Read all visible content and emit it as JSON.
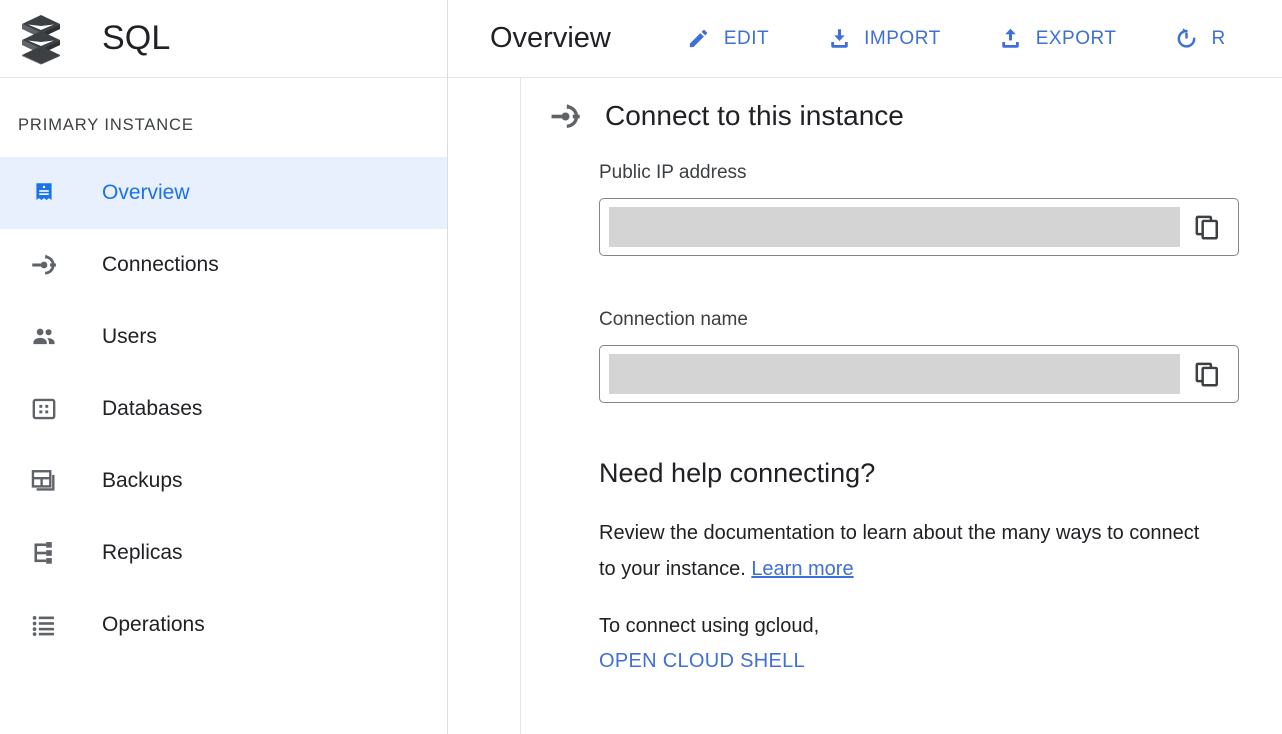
{
  "product": {
    "name": "SQL",
    "logo_icon": "cloud-sql-layers-logo"
  },
  "sidebar": {
    "section_label": "PRIMARY INSTANCE",
    "items": [
      {
        "label": "Overview",
        "icon": "overview-icon",
        "active": true
      },
      {
        "label": "Connections",
        "icon": "connections-icon",
        "active": false
      },
      {
        "label": "Users",
        "icon": "users-icon",
        "active": false
      },
      {
        "label": "Databases",
        "icon": "databases-icon",
        "active": false
      },
      {
        "label": "Backups",
        "icon": "backups-icon",
        "active": false
      },
      {
        "label": "Replicas",
        "icon": "replicas-icon",
        "active": false
      },
      {
        "label": "Operations",
        "icon": "operations-icon",
        "active": false
      }
    ]
  },
  "toolbar": {
    "page_title": "Overview",
    "actions": [
      {
        "label": "EDIT",
        "icon": "pencil-icon"
      },
      {
        "label": "IMPORT",
        "icon": "import-download-icon"
      },
      {
        "label": "EXPORT",
        "icon": "export-upload-icon"
      },
      {
        "label": "R",
        "icon": "restart-power-icon"
      }
    ],
    "annotation": {
      "shape": "ellipse",
      "color": "#e8381f",
      "targets": "IMPORT"
    }
  },
  "main": {
    "section_title": "Connect to this instance",
    "section_icon": "connections-icon",
    "fields": [
      {
        "label": "Public IP address",
        "value": "",
        "redacted": true,
        "copy_icon": "copy-icon"
      },
      {
        "label": "Connection name",
        "value": "",
        "redacted": true,
        "copy_icon": "copy-icon"
      }
    ],
    "help": {
      "title": "Need help connecting?",
      "body_before_link": "Review the documentation to learn about the many ways to connect to your instance. ",
      "link_label": "Learn more",
      "gcloud_text": "To connect using gcloud,",
      "shell_link_label": "OPEN CLOUD SHELL"
    }
  },
  "colors": {
    "accent_blue": "#3f6fd8",
    "active_nav_bg": "#e8f0fe",
    "annotation_red": "#e8381f",
    "icon_gray": "#5f6368",
    "redaction_gray": "#d4d4d4"
  }
}
